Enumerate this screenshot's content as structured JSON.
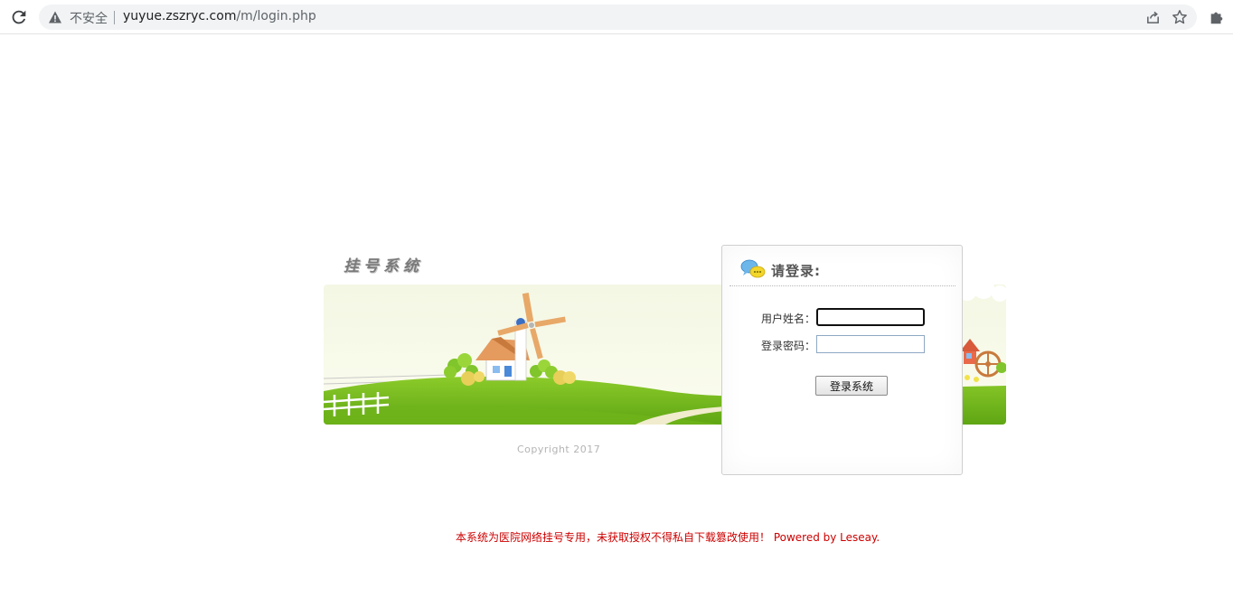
{
  "browser": {
    "security_label": "不安全",
    "url_host": "yuyue.zszryc.com",
    "url_path": "/m/login.php"
  },
  "page": {
    "system_title": "挂号系统",
    "copyright": "Copyright 2017",
    "footer_notice": "本系统为医院网络挂号专用，未获取授权不得私自下载篡改使用！ Powered by Leseay."
  },
  "login": {
    "title": "请登录:",
    "username_label": "用户姓名：",
    "username_value": "",
    "password_label": "登录密码：",
    "password_value": "",
    "submit_label": "登录系统"
  },
  "icons": {
    "reload": "reload-icon",
    "warning": "warning-icon",
    "share": "share-icon",
    "bookmark": "star-icon",
    "extensions": "puzzle-icon",
    "chat": "chat-bubbles-icon"
  },
  "colors": {
    "footer_text": "#cc0000",
    "banner_grass": "#7cbb1e",
    "windmill_blade": "#e8a868"
  }
}
